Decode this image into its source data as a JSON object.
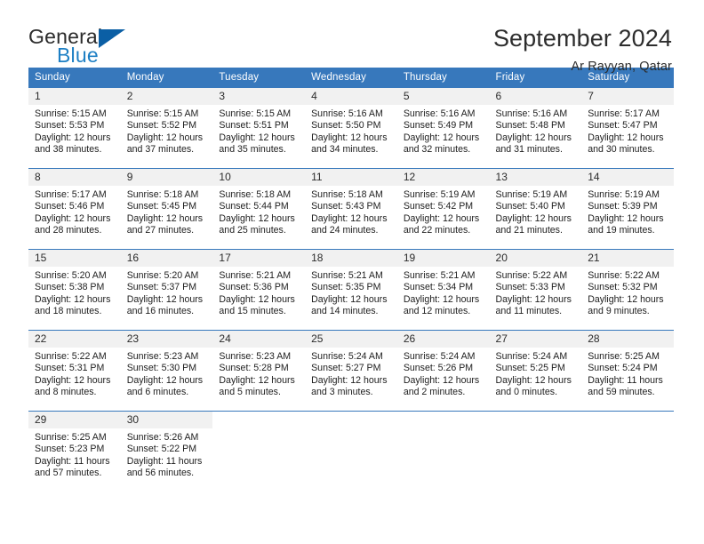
{
  "logo": {
    "word_top": "General",
    "word_bottom": "Blue",
    "accent_color": "#0b5fa5",
    "blue_text_color": "#1d7fc4"
  },
  "header": {
    "title": "September 2024",
    "subtitle": "Ar Rayyan, Qatar"
  },
  "calendar": {
    "header_bg": "#3778bc",
    "daynum_bg": "#f1f1f1",
    "weekdays": [
      "Sunday",
      "Monday",
      "Tuesday",
      "Wednesday",
      "Thursday",
      "Friday",
      "Saturday"
    ],
    "weeks": [
      [
        {
          "day": "1",
          "sunrise": "Sunrise: 5:15 AM",
          "sunset": "Sunset: 5:53 PM",
          "daylight1": "Daylight: 12 hours",
          "daylight2": "and 38 minutes."
        },
        {
          "day": "2",
          "sunrise": "Sunrise: 5:15 AM",
          "sunset": "Sunset: 5:52 PM",
          "daylight1": "Daylight: 12 hours",
          "daylight2": "and 37 minutes."
        },
        {
          "day": "3",
          "sunrise": "Sunrise: 5:15 AM",
          "sunset": "Sunset: 5:51 PM",
          "daylight1": "Daylight: 12 hours",
          "daylight2": "and 35 minutes."
        },
        {
          "day": "4",
          "sunrise": "Sunrise: 5:16 AM",
          "sunset": "Sunset: 5:50 PM",
          "daylight1": "Daylight: 12 hours",
          "daylight2": "and 34 minutes."
        },
        {
          "day": "5",
          "sunrise": "Sunrise: 5:16 AM",
          "sunset": "Sunset: 5:49 PM",
          "daylight1": "Daylight: 12 hours",
          "daylight2": "and 32 minutes."
        },
        {
          "day": "6",
          "sunrise": "Sunrise: 5:16 AM",
          "sunset": "Sunset: 5:48 PM",
          "daylight1": "Daylight: 12 hours",
          "daylight2": "and 31 minutes."
        },
        {
          "day": "7",
          "sunrise": "Sunrise: 5:17 AM",
          "sunset": "Sunset: 5:47 PM",
          "daylight1": "Daylight: 12 hours",
          "daylight2": "and 30 minutes."
        }
      ],
      [
        {
          "day": "8",
          "sunrise": "Sunrise: 5:17 AM",
          "sunset": "Sunset: 5:46 PM",
          "daylight1": "Daylight: 12 hours",
          "daylight2": "and 28 minutes."
        },
        {
          "day": "9",
          "sunrise": "Sunrise: 5:18 AM",
          "sunset": "Sunset: 5:45 PM",
          "daylight1": "Daylight: 12 hours",
          "daylight2": "and 27 minutes."
        },
        {
          "day": "10",
          "sunrise": "Sunrise: 5:18 AM",
          "sunset": "Sunset: 5:44 PM",
          "daylight1": "Daylight: 12 hours",
          "daylight2": "and 25 minutes."
        },
        {
          "day": "11",
          "sunrise": "Sunrise: 5:18 AM",
          "sunset": "Sunset: 5:43 PM",
          "daylight1": "Daylight: 12 hours",
          "daylight2": "and 24 minutes."
        },
        {
          "day": "12",
          "sunrise": "Sunrise: 5:19 AM",
          "sunset": "Sunset: 5:42 PM",
          "daylight1": "Daylight: 12 hours",
          "daylight2": "and 22 minutes."
        },
        {
          "day": "13",
          "sunrise": "Sunrise: 5:19 AM",
          "sunset": "Sunset: 5:40 PM",
          "daylight1": "Daylight: 12 hours",
          "daylight2": "and 21 minutes."
        },
        {
          "day": "14",
          "sunrise": "Sunrise: 5:19 AM",
          "sunset": "Sunset: 5:39 PM",
          "daylight1": "Daylight: 12 hours",
          "daylight2": "and 19 minutes."
        }
      ],
      [
        {
          "day": "15",
          "sunrise": "Sunrise: 5:20 AM",
          "sunset": "Sunset: 5:38 PM",
          "daylight1": "Daylight: 12 hours",
          "daylight2": "and 18 minutes."
        },
        {
          "day": "16",
          "sunrise": "Sunrise: 5:20 AM",
          "sunset": "Sunset: 5:37 PM",
          "daylight1": "Daylight: 12 hours",
          "daylight2": "and 16 minutes."
        },
        {
          "day": "17",
          "sunrise": "Sunrise: 5:21 AM",
          "sunset": "Sunset: 5:36 PM",
          "daylight1": "Daylight: 12 hours",
          "daylight2": "and 15 minutes."
        },
        {
          "day": "18",
          "sunrise": "Sunrise: 5:21 AM",
          "sunset": "Sunset: 5:35 PM",
          "daylight1": "Daylight: 12 hours",
          "daylight2": "and 14 minutes."
        },
        {
          "day": "19",
          "sunrise": "Sunrise: 5:21 AM",
          "sunset": "Sunset: 5:34 PM",
          "daylight1": "Daylight: 12 hours",
          "daylight2": "and 12 minutes."
        },
        {
          "day": "20",
          "sunrise": "Sunrise: 5:22 AM",
          "sunset": "Sunset: 5:33 PM",
          "daylight1": "Daylight: 12 hours",
          "daylight2": "and 11 minutes."
        },
        {
          "day": "21",
          "sunrise": "Sunrise: 5:22 AM",
          "sunset": "Sunset: 5:32 PM",
          "daylight1": "Daylight: 12 hours",
          "daylight2": "and 9 minutes."
        }
      ],
      [
        {
          "day": "22",
          "sunrise": "Sunrise: 5:22 AM",
          "sunset": "Sunset: 5:31 PM",
          "daylight1": "Daylight: 12 hours",
          "daylight2": "and 8 minutes."
        },
        {
          "day": "23",
          "sunrise": "Sunrise: 5:23 AM",
          "sunset": "Sunset: 5:30 PM",
          "daylight1": "Daylight: 12 hours",
          "daylight2": "and 6 minutes."
        },
        {
          "day": "24",
          "sunrise": "Sunrise: 5:23 AM",
          "sunset": "Sunset: 5:28 PM",
          "daylight1": "Daylight: 12 hours",
          "daylight2": "and 5 minutes."
        },
        {
          "day": "25",
          "sunrise": "Sunrise: 5:24 AM",
          "sunset": "Sunset: 5:27 PM",
          "daylight1": "Daylight: 12 hours",
          "daylight2": "and 3 minutes."
        },
        {
          "day": "26",
          "sunrise": "Sunrise: 5:24 AM",
          "sunset": "Sunset: 5:26 PM",
          "daylight1": "Daylight: 12 hours",
          "daylight2": "and 2 minutes."
        },
        {
          "day": "27",
          "sunrise": "Sunrise: 5:24 AM",
          "sunset": "Sunset: 5:25 PM",
          "daylight1": "Daylight: 12 hours",
          "daylight2": "and 0 minutes."
        },
        {
          "day": "28",
          "sunrise": "Sunrise: 5:25 AM",
          "sunset": "Sunset: 5:24 PM",
          "daylight1": "Daylight: 11 hours",
          "daylight2": "and 59 minutes."
        }
      ],
      [
        {
          "day": "29",
          "sunrise": "Sunrise: 5:25 AM",
          "sunset": "Sunset: 5:23 PM",
          "daylight1": "Daylight: 11 hours",
          "daylight2": "and 57 minutes."
        },
        {
          "day": "30",
          "sunrise": "Sunrise: 5:26 AM",
          "sunset": "Sunset: 5:22 PM",
          "daylight1": "Daylight: 11 hours",
          "daylight2": "and 56 minutes."
        },
        {
          "day": "",
          "sunrise": "",
          "sunset": "",
          "daylight1": "",
          "daylight2": ""
        },
        {
          "day": "",
          "sunrise": "",
          "sunset": "",
          "daylight1": "",
          "daylight2": ""
        },
        {
          "day": "",
          "sunrise": "",
          "sunset": "",
          "daylight1": "",
          "daylight2": ""
        },
        {
          "day": "",
          "sunrise": "",
          "sunset": "",
          "daylight1": "",
          "daylight2": ""
        },
        {
          "day": "",
          "sunrise": "",
          "sunset": "",
          "daylight1": "",
          "daylight2": ""
        }
      ]
    ]
  }
}
